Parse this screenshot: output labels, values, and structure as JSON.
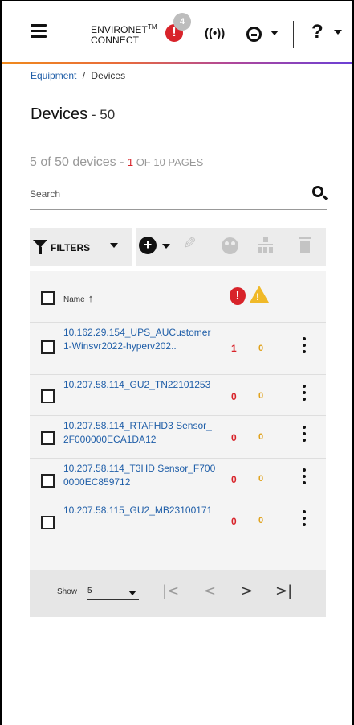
{
  "header": {
    "brand_line1": "ENVIRONET",
    "brand_tm": "TM",
    "brand_line2": "CONNECT",
    "alert_icon": "!",
    "alert_count": "4",
    "antenna_icon": "((•))",
    "help_icon": "?"
  },
  "breadcrumb": {
    "parent": "Equipment",
    "separator": "/",
    "current": "Devices"
  },
  "page": {
    "title": "Devices",
    "title_sep": " - ",
    "title_count": "50"
  },
  "summary": {
    "text": "5 of 50 devices - ",
    "page_num": "1",
    "page_text": " OF 10 PAGES"
  },
  "search": {
    "placeholder": "Search",
    "value": ""
  },
  "toolbar": {
    "filters_label": "FILTERS",
    "add_icon": "+",
    "edit_icon": "✎"
  },
  "table": {
    "header_name": "Name",
    "sort_arrow": "↑",
    "alert_header": "!",
    "warn_header": "!",
    "rows": [
      {
        "name": "10.162.29.154_UPS_AUCustomer1-Winsvr2022-hyperv202..",
        "alerts": "1",
        "warnings": "0"
      },
      {
        "name": "10.207.58.114_GU2_TN22101253",
        "alerts": "0",
        "warnings": "0"
      },
      {
        "name": "10.207.58.114_RTAFHD3 Sensor_2F000000ECA1DA12",
        "alerts": "0",
        "warnings": "0"
      },
      {
        "name": "10.207.58.114_T3HD Sensor_F7000000EC859712",
        "alerts": "0",
        "warnings": "0"
      },
      {
        "name": "10.207.58.115_GU2_MB23100171",
        "alerts": "0",
        "warnings": "0"
      }
    ]
  },
  "pager": {
    "show_label": "Show",
    "page_size": "5",
    "first": "|<",
    "prev": "<",
    "next": ">",
    "last": ">|"
  }
}
